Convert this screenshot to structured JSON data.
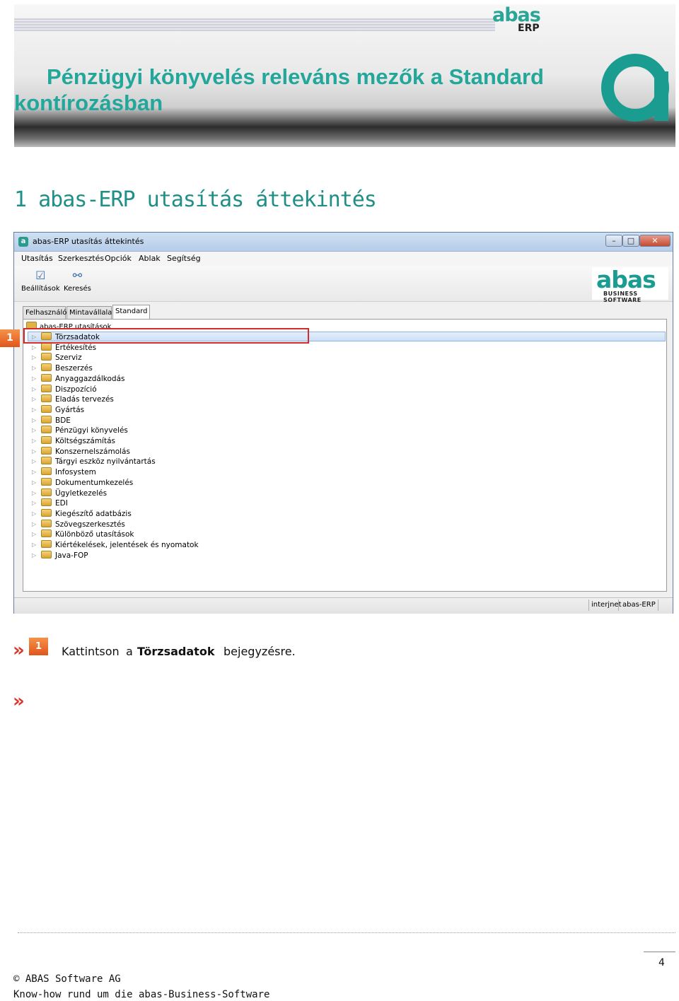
{
  "header": {
    "logo_word": "abas",
    "logo_sub": "ERP",
    "title": "Pénzügyi könyvelés releváns mezők a Standard kontírozásban",
    "brand_color": "#23a79a"
  },
  "section": {
    "heading": "1 abas-ERP utasítás áttekintés"
  },
  "window": {
    "title": "abas-ERP utasítás áttekintés",
    "menu": [
      "Utasítás",
      "Szerkesztés",
      "Opciók",
      "Ablak",
      "Segítség"
    ],
    "toolbar": [
      {
        "label": "Beállítások",
        "icon": "checklist-icon"
      },
      {
        "label": "Keresés",
        "icon": "binoculars-icon"
      }
    ],
    "logo_word": "abas",
    "logo_sub": "BUSINESS SOFTWARE",
    "tabs": [
      "Felhasználó",
      "Mintavállalat",
      "Standard"
    ],
    "active_tab": "Standard",
    "tree_root": "abas-ERP utasítások",
    "tree_items": [
      "Törzsadatok",
      "Értékesítés",
      "Szerviz",
      "Beszerzés",
      "Anyaggazdálkodás",
      "Diszpozíció",
      "Eladás tervezés",
      "Gyártás",
      "BDE",
      "Pénzügyi könyvelés",
      "Költségszámítás",
      "Konszernelszámolás",
      "Tárgyi eszköz nyilvántartás",
      "Infosystem",
      "Dokumentumkezelés",
      "Ügyletkezelés",
      "EDI",
      "Kiegészítő adatbázis",
      "Szövegszerkesztés",
      "Különböző utasítások",
      "Kiértékelések, jelentések és nyomatok",
      "Java-FOP"
    ],
    "selected_item": "Törzsadatok",
    "status": [
      "interjnet",
      "abas-ERP"
    ]
  },
  "callout": {
    "marker": "1",
    "highlight_color": "#d62b2b"
  },
  "instructions": {
    "bullet": "»",
    "step_marker": "1",
    "word1": "Kattintson",
    "word2": "a",
    "term": "Törzsadatok",
    "word3": "bejegyzésre."
  },
  "footer": {
    "page": "4",
    "copyright": "© ABAS Software AG",
    "tagline": "Know-how rund um die abas-Business-Software"
  }
}
